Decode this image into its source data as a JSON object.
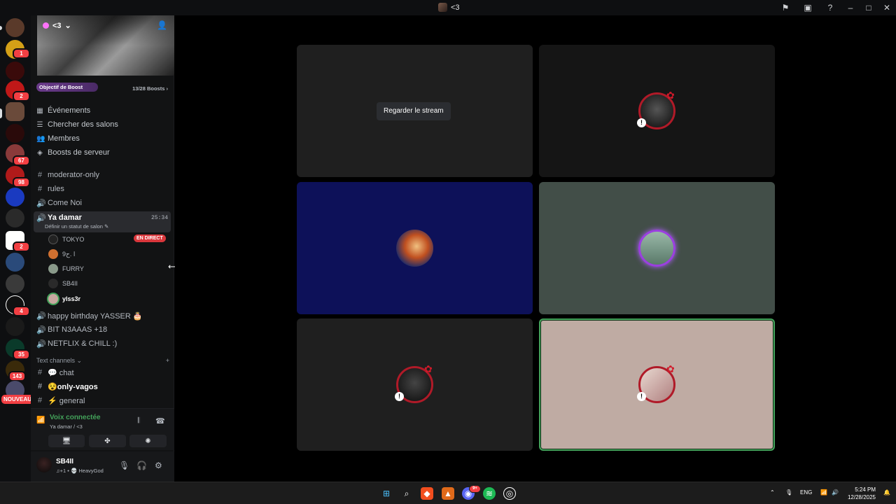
{
  "window": {
    "title": "<3",
    "icons": [
      "flag-icon",
      "inbox-icon",
      "help-icon",
      "minimize-icon",
      "maximize-icon",
      "close-icon"
    ]
  },
  "guilds": {
    "badges": [
      "1",
      "2",
      "67",
      "98",
      "2",
      "4",
      "35",
      "143"
    ],
    "new_label": "NOUVEAU"
  },
  "server": {
    "name": "<3",
    "boost_goal_label": "Objectif de Boost",
    "boost_count": "13/28 Boosts"
  },
  "menu": [
    {
      "label": "Événements",
      "icon": "calendar-icon"
    },
    {
      "label": "Chercher des salons",
      "icon": "browse-channels-icon"
    },
    {
      "label": "Membres",
      "icon": "members-icon"
    },
    {
      "label": "Boosts de serveur",
      "icon": "boost-icon"
    }
  ],
  "channels": {
    "moderator": "moderator-only",
    "rules": "rules",
    "come": "Come Noi",
    "active": {
      "name": "Ya damar",
      "status": "Définir un statut de salon",
      "timer": "25:34"
    },
    "members": [
      {
        "name": "TOKYO",
        "live": "EN DIRECT"
      },
      {
        "name": "ا .ح9"
      },
      {
        "name": "FURRY"
      },
      {
        "name": "SB4II"
      },
      {
        "name": "ylss3r"
      }
    ],
    "birthday": "happy birthday YASSER 🎂",
    "bit": "BIT N3AAAS +18",
    "netflix": "NETFLIX & CHILL :)",
    "text_category": "Text channels",
    "chat": "💬 chat",
    "vagos": "😵only-vagos",
    "general": "⚡ general"
  },
  "voice_panel": {
    "title": "Voix connectée",
    "subtitle": "Ya damar / <3"
  },
  "user": {
    "name": "SB4II",
    "status": "♫+1 • 💀 HeavyGod"
  },
  "stage": {
    "watch_stream": "Regarder le stream",
    "colors": {
      "tile_dark": "#1f1f1f",
      "tile_navy": "#0d1159",
      "tile_slate": "#424e48",
      "tile_rose": "#bfaba3",
      "tile_black": "#151515",
      "speaking": "#43a25a"
    }
  },
  "taskbar": {
    "lang": "ENG",
    "time": "5:24 PM",
    "date": "12/28/2025",
    "discord_badge": "9+"
  }
}
